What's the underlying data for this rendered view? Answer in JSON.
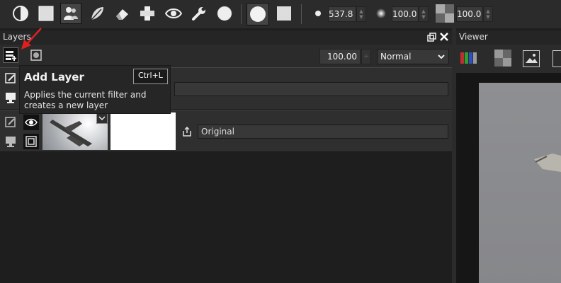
{
  "toolbar": {
    "size_value": "537.8",
    "hardness_value": "100.0",
    "opacity_value": "100.0",
    "tools": [
      "contrast-icon",
      "gray-square-icon",
      "people-icon",
      "feather-icon",
      "eraser-icon",
      "blur-icon",
      "eye-icon",
      "wrench-icon",
      "dots-circle-icon"
    ]
  },
  "layers_panel": {
    "title": "Layers",
    "opacity": "100.00",
    "blend_mode": "Normal",
    "layer_name": "Original"
  },
  "viewer": {
    "title": "Viewer"
  },
  "tooltip": {
    "title": "Add Layer",
    "shortcut": "Ctrl+L",
    "description": "Applies the current filter and creates a new layer"
  },
  "colors": {
    "annotation_arrow": "#e02020",
    "panel_bg": "#2b2b2b",
    "tooltip_bg": "#262626"
  }
}
